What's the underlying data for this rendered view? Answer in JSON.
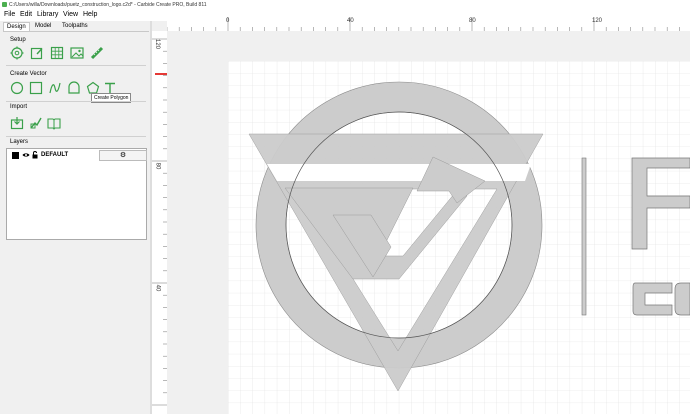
{
  "window": {
    "title": "C:/Users/willa/Downloads/puetz_construction_logo.c2d* - Carbide Create PRO, Build 811"
  },
  "menu": [
    "File",
    "Edit",
    "Library",
    "View",
    "Help"
  ],
  "tabs": [
    "Design",
    "Model",
    "Toolpaths"
  ],
  "sections": {
    "setup": "Setup",
    "create_vector": "Create Vector",
    "import": "Import",
    "layers": "Layers"
  },
  "tooltip": "Create Polygon",
  "layers": [
    {
      "name": "DEFAULT",
      "color": "#000000"
    }
  ],
  "rulers": {
    "x_labels": [
      "0",
      "40",
      "80",
      "120"
    ],
    "y_labels": [
      "120",
      "80",
      "40"
    ]
  },
  "colors": {
    "accent": "#3aa04a",
    "logo_fill": "#cccccc",
    "ruler_marker": "#e53935"
  },
  "icons": {
    "setup": [
      "job-setup-icon",
      "edit-icon",
      "grid-icon",
      "image-icon",
      "measure-icon"
    ],
    "create_vector": [
      "circle-icon",
      "rectangle-icon",
      "curve-icon",
      "arch-icon",
      "polygon-icon",
      "text-icon"
    ],
    "import": [
      "import-icon",
      "import-svg-icon",
      "library-icon"
    ]
  }
}
